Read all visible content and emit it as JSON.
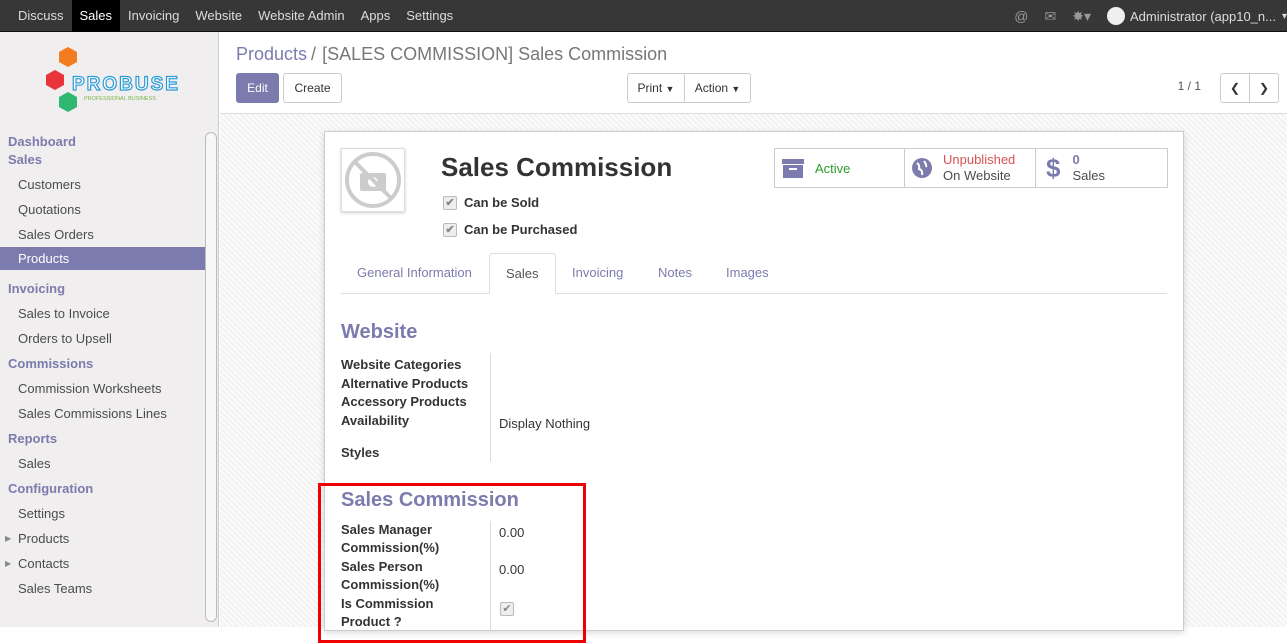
{
  "topbar": {
    "menu": [
      "Discuss",
      "Sales",
      "Invoicing",
      "Website",
      "Website Admin",
      "Apps",
      "Settings"
    ],
    "active": "Sales",
    "user": "Administrator (app10_n..."
  },
  "logo": {
    "name": "PROBUSE",
    "tagline": "PROFESSIONAL BUSINESS"
  },
  "sidebar": {
    "dashboard": "Dashboard",
    "sales_header": "Sales",
    "sales_items": [
      "Customers",
      "Quotations",
      "Sales Orders",
      "Products"
    ],
    "invoicing_header": "Invoicing",
    "invoicing_items": [
      "Sales to Invoice",
      "Orders to Upsell"
    ],
    "commissions_header": "Commissions",
    "commissions_items": [
      "Commission Worksheets",
      "Sales Commissions Lines"
    ],
    "reports_header": "Reports",
    "reports_items": [
      "Sales"
    ],
    "config_header": "Configuration",
    "config_items": [
      "Settings",
      "Products",
      "Contacts",
      "Sales Teams"
    ]
  },
  "breadcrumb": {
    "parent": "Products",
    "separator": "/",
    "current": "[SALES COMMISSION] Sales Commission"
  },
  "buttons": {
    "edit": "Edit",
    "create": "Create",
    "print": "Print",
    "action": "Action"
  },
  "pager": "1 / 1",
  "product": {
    "name": "Sales Commission",
    "can_be_sold": "Can be Sold",
    "can_be_purchased": "Can be Purchased"
  },
  "stats": {
    "active": "Active",
    "unpublished": "Unpublished",
    "on_website": "On Website",
    "sales_count": "0",
    "sales_label": "Sales"
  },
  "tabs": [
    "General Information",
    "Sales",
    "Invoicing",
    "Notes",
    "Images"
  ],
  "website": {
    "header": "Website",
    "labels": [
      "Website Categories",
      "Alternative Products",
      "Accessory Products",
      "Availability",
      "Styles"
    ],
    "availability_value": "Display Nothing"
  },
  "commission": {
    "header": "Sales Commission",
    "manager_label": "Sales Manager Commission(%)",
    "manager_value": "0.00",
    "person_label": "Sales Person Commission(%)",
    "person_value": "0.00",
    "is_product_label": "Is Commission Product ?"
  },
  "colors": {
    "accent": "#7c7bad",
    "highlight": "#e00000",
    "active_green": "#2e9a2e",
    "unpublished_red": "#d9534f"
  }
}
